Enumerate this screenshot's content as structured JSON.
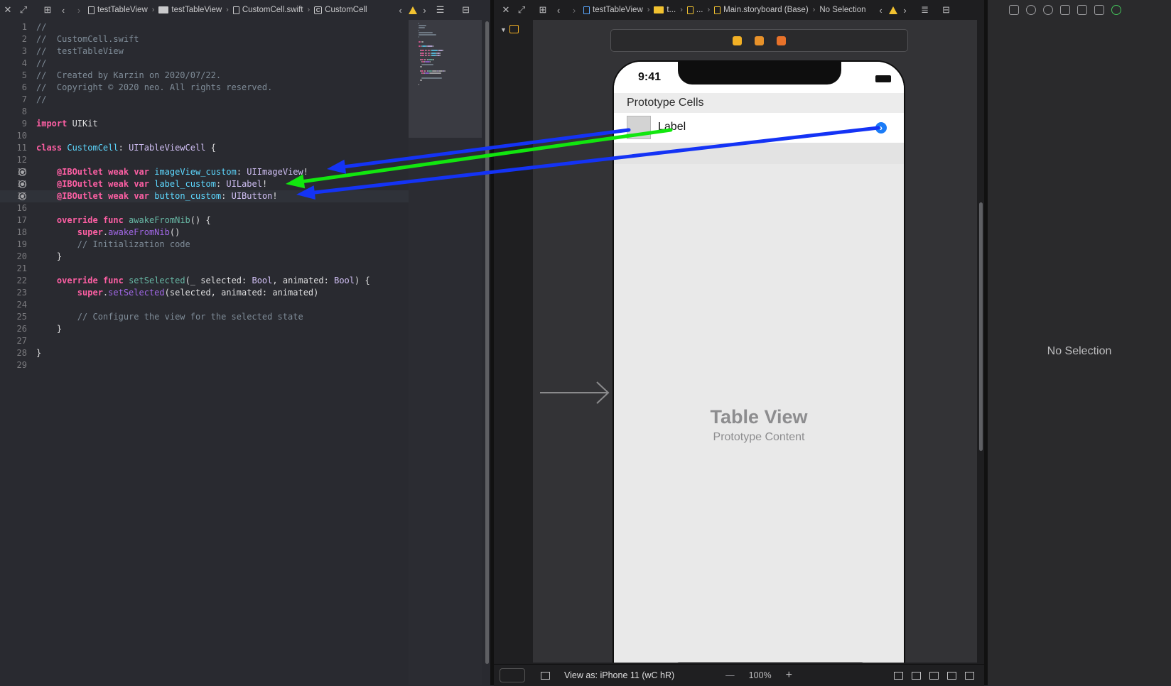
{
  "left_editor": {
    "breadcrumbs": [
      "testTableView",
      "testTableView",
      "CustomCell.swift",
      "CustomCell"
    ],
    "lines": [
      {
        "n": "1",
        "segs": [
          {
            "t": "//",
            "c": "com"
          }
        ]
      },
      {
        "n": "2",
        "segs": [
          {
            "t": "//  CustomCell.swift",
            "c": "com"
          }
        ]
      },
      {
        "n": "3",
        "segs": [
          {
            "t": "//  testTableView",
            "c": "com"
          }
        ]
      },
      {
        "n": "4",
        "segs": [
          {
            "t": "//",
            "c": "com"
          }
        ]
      },
      {
        "n": "5",
        "segs": [
          {
            "t": "//  Created by Karzin on 2020/07/22.",
            "c": "com"
          }
        ]
      },
      {
        "n": "6",
        "segs": [
          {
            "t": "//  Copyright © 2020 neo. All rights reserved.",
            "c": "com"
          }
        ]
      },
      {
        "n": "7",
        "segs": [
          {
            "t": "//",
            "c": "com"
          }
        ]
      },
      {
        "n": "8",
        "segs": []
      },
      {
        "n": "9",
        "segs": [
          {
            "t": "import",
            "c": "kw"
          },
          {
            "t": " UIKit",
            "c": "plain"
          }
        ]
      },
      {
        "n": "10",
        "segs": []
      },
      {
        "n": "11",
        "segs": [
          {
            "t": "class",
            "c": "kw"
          },
          {
            "t": " ",
            "c": "plain"
          },
          {
            "t": "CustomCell",
            "c": "type"
          },
          {
            "t": ": ",
            "c": "plain"
          },
          {
            "t": "UITableViewCell",
            "c": "sys"
          },
          {
            "t": " {",
            "c": "plain"
          }
        ]
      },
      {
        "n": "12",
        "segs": []
      },
      {
        "n": "13",
        "outlet": true,
        "segs": [
          {
            "t": "    ",
            "c": "plain"
          },
          {
            "t": "@IBOutlet",
            "c": "kw"
          },
          {
            "t": " ",
            "c": "plain"
          },
          {
            "t": "weak",
            "c": "kw"
          },
          {
            "t": " ",
            "c": "plain"
          },
          {
            "t": "var",
            "c": "kw"
          },
          {
            "t": " ",
            "c": "plain"
          },
          {
            "t": "imageView_custom",
            "c": "type"
          },
          {
            "t": ": ",
            "c": "plain"
          },
          {
            "t": "UIImageView",
            "c": "sys"
          },
          {
            "t": "!",
            "c": "plain"
          }
        ]
      },
      {
        "n": "14",
        "outlet": true,
        "segs": [
          {
            "t": "    ",
            "c": "plain"
          },
          {
            "t": "@IBOutlet",
            "c": "kw"
          },
          {
            "t": " ",
            "c": "plain"
          },
          {
            "t": "weak",
            "c": "kw"
          },
          {
            "t": " ",
            "c": "plain"
          },
          {
            "t": "var",
            "c": "kw"
          },
          {
            "t": " ",
            "c": "plain"
          },
          {
            "t": "label_custom",
            "c": "type"
          },
          {
            "t": ": ",
            "c": "plain"
          },
          {
            "t": "UILabel",
            "c": "sys"
          },
          {
            "t": "!",
            "c": "plain"
          }
        ]
      },
      {
        "n": "15",
        "outlet": true,
        "hl": true,
        "segs": [
          {
            "t": "    ",
            "c": "plain"
          },
          {
            "t": "@IBOutlet",
            "c": "kw"
          },
          {
            "t": " ",
            "c": "plain"
          },
          {
            "t": "weak",
            "c": "kw"
          },
          {
            "t": " ",
            "c": "plain"
          },
          {
            "t": "var",
            "c": "kw"
          },
          {
            "t": " ",
            "c": "plain"
          },
          {
            "t": "button_custom",
            "c": "type"
          },
          {
            "t": ": ",
            "c": "plain"
          },
          {
            "t": "UIButton",
            "c": "sys"
          },
          {
            "t": "!",
            "c": "plain"
          }
        ]
      },
      {
        "n": "16",
        "segs": []
      },
      {
        "n": "17",
        "segs": [
          {
            "t": "    ",
            "c": "plain"
          },
          {
            "t": "override",
            "c": "kw"
          },
          {
            "t": " ",
            "c": "plain"
          },
          {
            "t": "func",
            "c": "kw"
          },
          {
            "t": " ",
            "c": "plain"
          },
          {
            "t": "awakeFromNib",
            "c": "func"
          },
          {
            "t": "() {",
            "c": "plain"
          }
        ]
      },
      {
        "n": "18",
        "segs": [
          {
            "t": "        ",
            "c": "plain"
          },
          {
            "t": "super",
            "c": "kw"
          },
          {
            "t": ".",
            "c": "plain"
          },
          {
            "t": "awakeFromNib",
            "c": "call"
          },
          {
            "t": "()",
            "c": "plain"
          }
        ]
      },
      {
        "n": "19",
        "segs": [
          {
            "t": "        // Initialization code",
            "c": "com"
          }
        ]
      },
      {
        "n": "20",
        "segs": [
          {
            "t": "    }",
            "c": "plain"
          }
        ]
      },
      {
        "n": "21",
        "segs": []
      },
      {
        "n": "22",
        "segs": [
          {
            "t": "    ",
            "c": "plain"
          },
          {
            "t": "override",
            "c": "kw"
          },
          {
            "t": " ",
            "c": "plain"
          },
          {
            "t": "func",
            "c": "kw"
          },
          {
            "t": " ",
            "c": "plain"
          },
          {
            "t": "setSelected",
            "c": "func"
          },
          {
            "t": "(_ selected: ",
            "c": "plain"
          },
          {
            "t": "Bool",
            "c": "sys"
          },
          {
            "t": ", animated: ",
            "c": "plain"
          },
          {
            "t": "Bool",
            "c": "sys"
          },
          {
            "t": ") {",
            "c": "plain"
          }
        ]
      },
      {
        "n": "23",
        "segs": [
          {
            "t": "        ",
            "c": "plain"
          },
          {
            "t": "super",
            "c": "kw"
          },
          {
            "t": ".",
            "c": "plain"
          },
          {
            "t": "setSelected",
            "c": "call"
          },
          {
            "t": "(selected, animated: animated)",
            "c": "plain"
          }
        ]
      },
      {
        "n": "24",
        "segs": []
      },
      {
        "n": "25",
        "segs": [
          {
            "t": "        // Configure the view for the selected state",
            "c": "com"
          }
        ]
      },
      {
        "n": "26",
        "segs": [
          {
            "t": "    }",
            "c": "plain"
          }
        ]
      },
      {
        "n": "27",
        "segs": []
      },
      {
        "n": "28",
        "segs": [
          {
            "t": "}",
            "c": "plain"
          }
        ]
      },
      {
        "n": "29",
        "segs": []
      }
    ]
  },
  "ib_editor": {
    "breadcrumbs": [
      "testTableView",
      "t...",
      "...",
      "Main.storyboard (Base)",
      "No Selection"
    ],
    "prototype_header": "Prototype Cells",
    "status_time": "9:41",
    "cell_label": "Label",
    "table_view_title": "Table View",
    "table_view_subtitle": "Prototype Content",
    "view_as": "View as: iPhone 11 (wC hR)",
    "zoom": "100%",
    "zoom_minus": "—",
    "zoom_plus": "+"
  },
  "inspector": {
    "placeholder": "No Selection"
  },
  "colors": {
    "connection_blue": "#1433f5",
    "connection_green": "#12e60f",
    "accent_blue": "#1b7cf7",
    "warning_yellow": "#f2c230"
  },
  "icons": {
    "close": "close-icon",
    "expand": "expand-icon",
    "related": "related-items-icon",
    "back": "chevron-left-icon",
    "forward": "chevron-right-icon",
    "warning": "warning-icon",
    "outlet": "outlet-connection-icon"
  }
}
